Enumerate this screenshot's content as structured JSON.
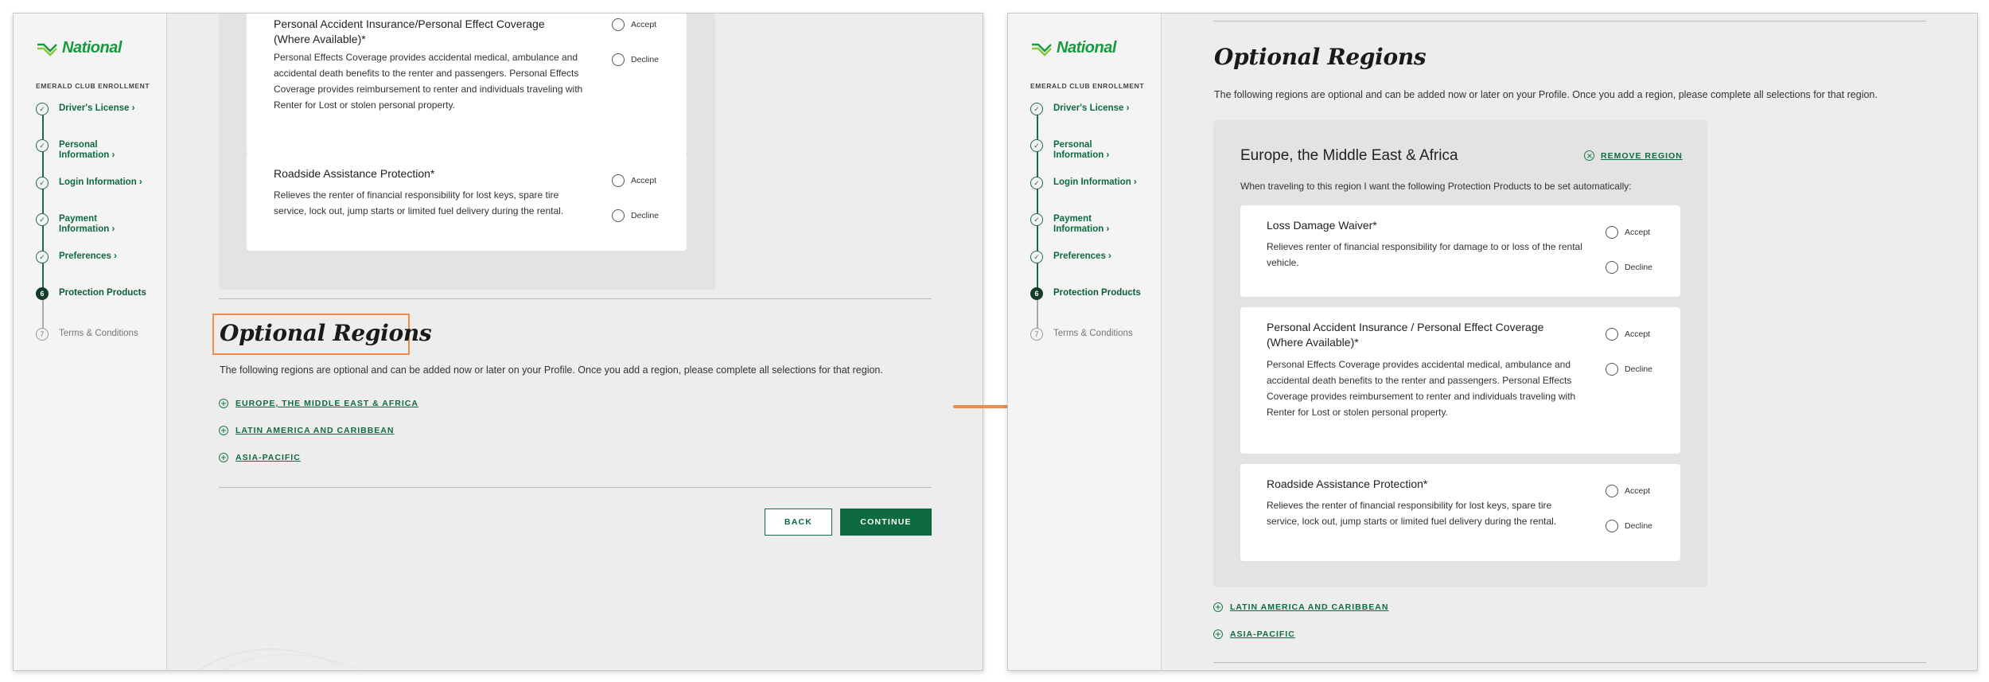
{
  "brand": {
    "name": "National",
    "color": "#169a3e",
    "accent": "#0d6b3f",
    "highlight": "#f08c4a"
  },
  "enrollment_title": "EMERALD CLUB ENROLLMENT",
  "steps": [
    {
      "label": "Driver's License ›",
      "status": "done",
      "icon": "check-icon"
    },
    {
      "label": "Personal Information ›",
      "status": "done",
      "icon": "check-icon"
    },
    {
      "label": "Login Information ›",
      "status": "done",
      "icon": "check-icon"
    },
    {
      "label": "Payment Information ›",
      "status": "done",
      "icon": "check-icon"
    },
    {
      "label": "Preferences ›",
      "status": "done",
      "icon": "check-icon"
    },
    {
      "label": "Protection Products",
      "status": "current",
      "number": "6"
    },
    {
      "label": "Terms & Conditions",
      "status": "todo",
      "number": "7"
    }
  ],
  "options": {
    "accept": "Accept",
    "decline": "Decline"
  },
  "left": {
    "products": [
      {
        "title": "Personal Accident Insurance/Personal Effect Coverage (Where Available)*",
        "description": "Personal Effects Coverage provides accidental medical, ambulance and accidental death benefits to the renter and passengers. Personal Effects Coverage provides reimbursement to renter and individuals traveling with Renter for Lost or stolen personal property."
      },
      {
        "title": "Roadside Assistance Protection*",
        "description": "Relieves the renter of financial responsibility for lost keys, spare tire service, lock out, jump starts or limited fuel delivery during the rental."
      }
    ],
    "heading": "Optional Regions",
    "intro": "The following regions are optional and can be added now or later on your Profile. Once you add a region, please complete all selections for that region.",
    "regions": [
      "EUROPE, THE MIDDLE EAST & AFRICA",
      "LATIN AMERICA AND CARIBBEAN",
      "ASIA-PACIFIC"
    ],
    "back": "BACK",
    "continue": "CONTINUE"
  },
  "right": {
    "heading": "Optional Regions",
    "intro": "The following regions are optional and can be added now or later on your Profile. Once you add a region, please complete all selections for that region.",
    "region_title": "Europe, the Middle East & Africa",
    "remove_label": "REMOVE REGION",
    "region_note": "When traveling to this region I want the following Protection Products to be set automatically:",
    "products": [
      {
        "title": "Loss Damage Waiver*",
        "description": "Relieves renter of financial responsibility for damage to or loss of the rental vehicle."
      },
      {
        "title": "Personal Accident Insurance / Personal Effect Coverage (Where Available)*",
        "description": "Personal Effects Coverage provides accidental medical, ambulance and accidental death benefits to the renter and passengers. Personal Effects Coverage provides reimbursement to renter and individuals traveling with Renter for Lost or stolen personal property."
      },
      {
        "title": "Roadside Assistance Protection*",
        "description": "Relieves the renter of financial responsibility for lost keys, spare tire service, lock out, jump starts or limited fuel delivery during the rental."
      }
    ],
    "other_regions": [
      "LATIN AMERICA AND CARIBBEAN",
      "ASIA-PACIFIC"
    ]
  }
}
